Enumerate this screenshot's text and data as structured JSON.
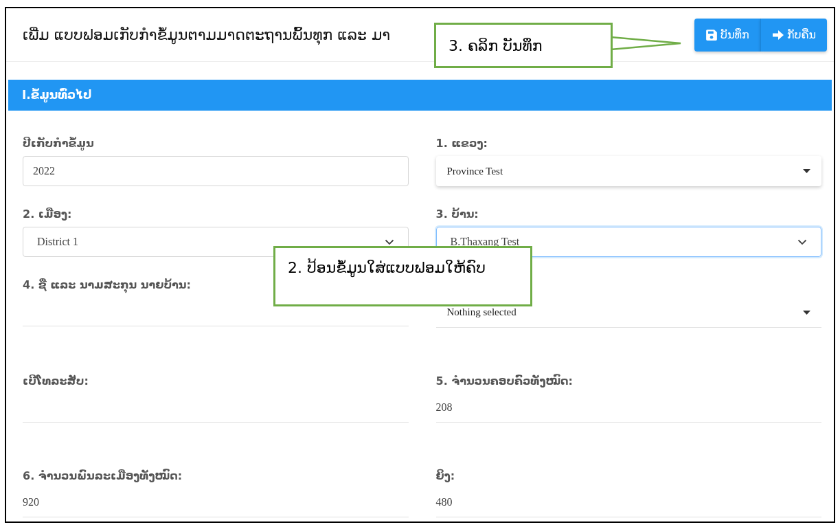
{
  "header": {
    "title": "ເພີ່ມ ແບບຟອມເກັບກຳຂໍ້ມູນຕາມມາດຕະຖານພົ້ນທຸກ ແລະ ມາ"
  },
  "buttons": [
    {
      "kind": "save",
      "label": "ບັນທຶກ"
    },
    {
      "kind": "back",
      "label": "ກັບຄືນ"
    }
  ],
  "section": {
    "title": "I.ຂໍ້ມູນທົ່ວໄປ"
  },
  "fields": [
    {
      "label": "ປີເກັບກຳຂໍ້ມູນ",
      "kind": "input",
      "value": "2022",
      "focused": false
    },
    {
      "label": "1. ແຂວງ:",
      "kind": "dropdown",
      "value": "Province Test",
      "focused": false
    },
    {
      "label": "2. ເມືອງ:",
      "kind": "select",
      "value": "District 1",
      "focused": false
    },
    {
      "label": "3. ບ້ານ:",
      "kind": "select",
      "value": "B.Thaxang Test",
      "focused": true
    },
    {
      "label": "4. ຊື່ ແລະ ນາມສະກຸນ ນາຍບ້ານ:",
      "kind": "line",
      "focused": false
    },
    {
      "kind": "dropdown-line",
      "value": "Nothing selected",
      "focused": false
    },
    {
      "label": "ເບີໂທລະສັບ:",
      "kind": "line",
      "focused": false
    },
    {
      "label": "5. ຈຳນວນຄອບຄົວທັງໝົດ:",
      "kind": "line",
      "value": "208",
      "focused": false
    },
    {
      "label": "6. ຈຳນວນພົນລະເມືອງທັງໝົດ:",
      "kind": "line",
      "value": "920",
      "focused": false
    },
    {
      "label": "ຍິງ:",
      "kind": "line",
      "value": "480",
      "focused": false
    }
  ],
  "callouts": [
    {
      "kind": "form",
      "text": "2. ປ້ອນຂໍ້ມູນໃສ່ແບບຟອມໃຫ້ຄົບ"
    },
    {
      "kind": "save",
      "text": "3. ຄລິກ ບັນທຶກ"
    }
  ]
}
